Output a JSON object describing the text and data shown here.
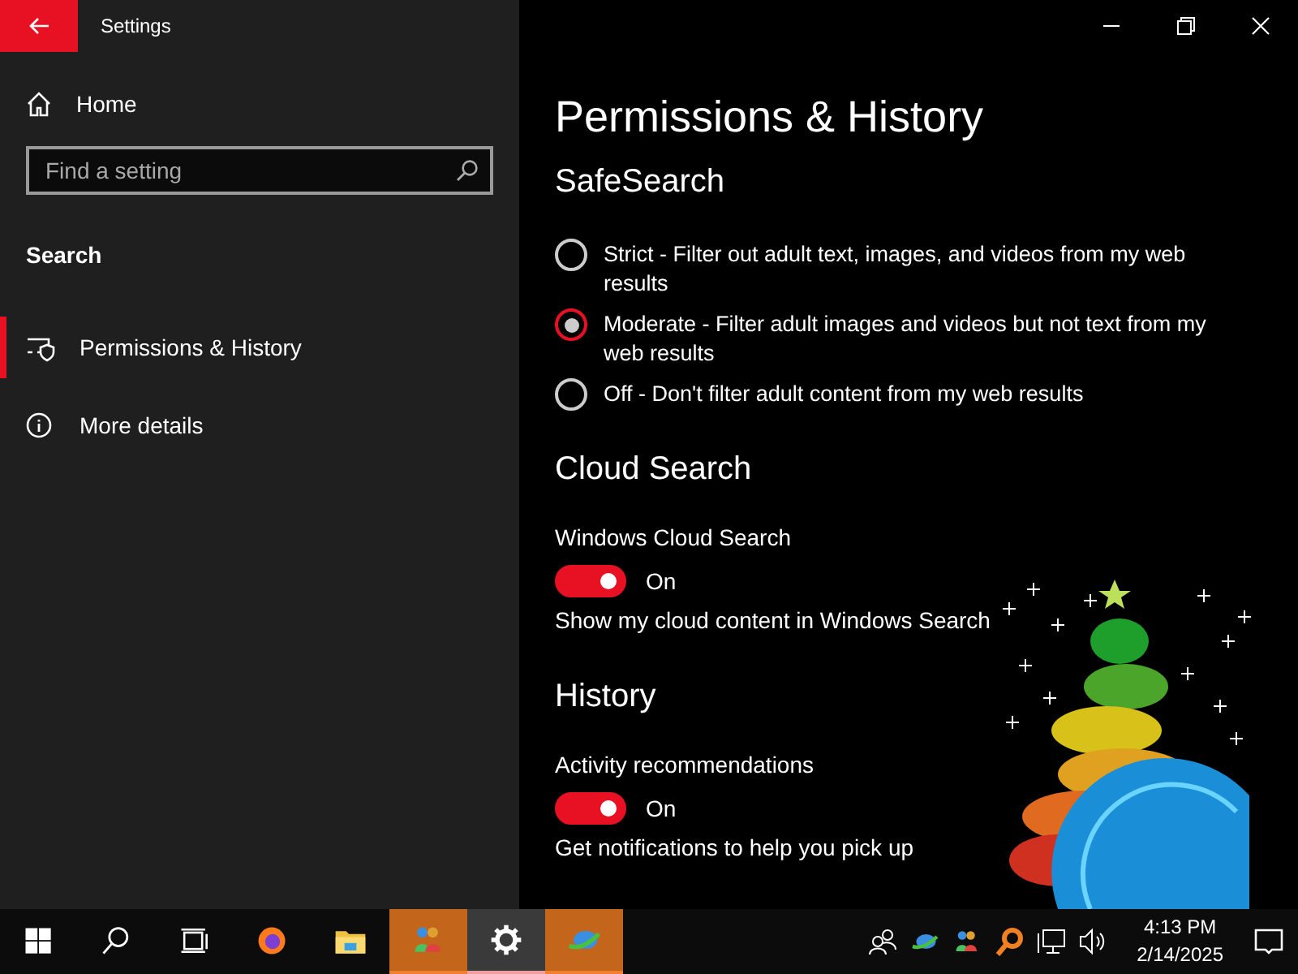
{
  "window": {
    "title": "Settings"
  },
  "sidebar": {
    "home": "Home",
    "search": {
      "placeholder": "Find a setting"
    },
    "section": "Search",
    "items": [
      {
        "label": "Permissions & History",
        "kind": "permissions",
        "selected": true
      },
      {
        "label": "More details",
        "kind": "info",
        "selected": false
      }
    ]
  },
  "content": {
    "title": "Permissions & History",
    "sections": [
      {
        "heading": "SafeSearch",
        "radios": [
          {
            "label": "Strict - Filter out adult text, images, and videos from my web results",
            "selected": false
          },
          {
            "label": "Moderate - Filter adult images and videos but not text from my web results",
            "selected": true
          },
          {
            "label": "Off - Don't filter adult content from my web results",
            "selected": false
          }
        ]
      },
      {
        "heading": "Cloud Search",
        "settings": [
          {
            "label": "Windows Cloud Search",
            "on": true,
            "state_text": "On",
            "description": "Show my cloud content in Windows Search"
          }
        ]
      },
      {
        "heading": "History",
        "settings": [
          {
            "label": "Activity recommendations",
            "on": true,
            "state_text": "On",
            "description": "Get notifications to help you pick up"
          }
        ]
      }
    ]
  },
  "taskbar": {
    "apps": [
      {
        "kind": "start",
        "running": false,
        "selected": false
      },
      {
        "kind": "search",
        "running": false,
        "selected": false
      },
      {
        "kind": "taskview",
        "running": false,
        "selected": false
      },
      {
        "kind": "browser",
        "running": false,
        "selected": false
      },
      {
        "kind": "folder",
        "running": false,
        "selected": false
      },
      {
        "kind": "people-app",
        "running": true,
        "selected": false
      },
      {
        "kind": "settings",
        "running": true,
        "selected": true
      },
      {
        "kind": "globe-app",
        "running": true,
        "selected": false
      }
    ],
    "time": "4:13 PM",
    "date": "2/14/2025"
  }
}
